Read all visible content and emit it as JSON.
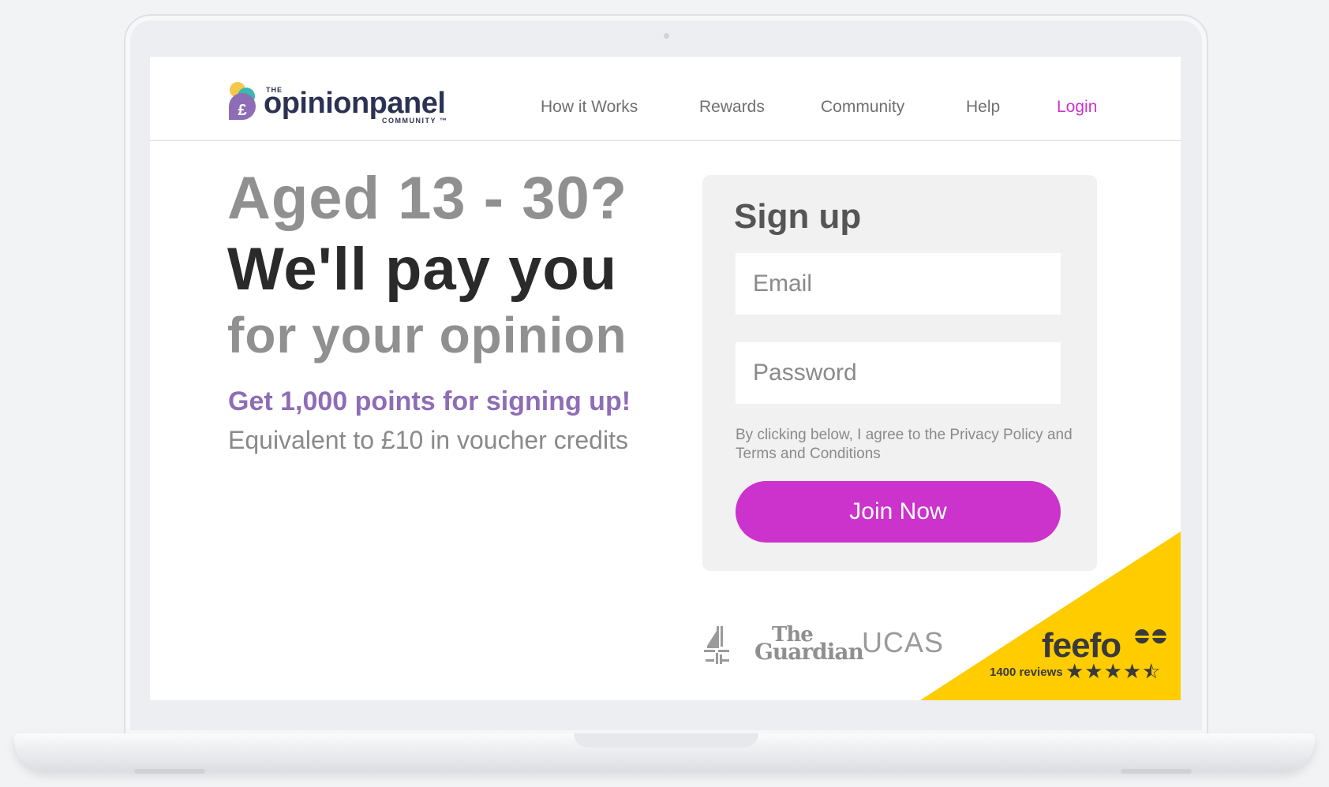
{
  "brand": {
    "the": "THE",
    "name": "opinionpanel",
    "sub": "COMMUNITY ™"
  },
  "nav": {
    "how_it_works": "How it Works",
    "rewards": "Rewards",
    "community": "Community",
    "help": "Help",
    "login": "Login"
  },
  "hero": {
    "line1": "Aged 13 - 30?",
    "line2": "We'll pay you",
    "line3": "for your opinion",
    "offer": "Get 1,000 points for signing up!",
    "sub": "Equivalent to £10 in voucher credits"
  },
  "signup": {
    "title": "Sign up",
    "email_placeholder": "Email",
    "password_placeholder": "Password",
    "terms": "By clicking below, I agree to the Privacy Policy and Terms and Conditions",
    "button": "Join Now"
  },
  "press": {
    "guardian_top": "The",
    "guardian_bottom": "Guardian",
    "ucas": "UCAS"
  },
  "feefo": {
    "logo": "feefo",
    "reviews": "1400 reviews",
    "stars": "★★★★",
    "rating": 4.5
  },
  "colors": {
    "accent": "#cc33cc",
    "offer_purple": "#8e6db6",
    "feefo_yellow": "#ffcc00",
    "brand_navy": "#2c3252"
  }
}
